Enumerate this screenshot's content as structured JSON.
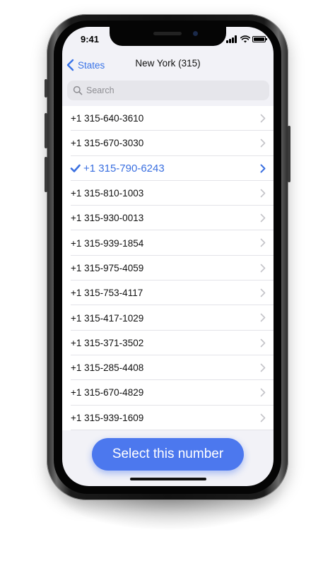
{
  "status_bar": {
    "time": "9:41"
  },
  "nav": {
    "back_label": "States",
    "title": "New York (315)"
  },
  "search": {
    "placeholder": "Search",
    "value": ""
  },
  "numbers": [
    {
      "label": "+1 315-640-3610",
      "selected": false
    },
    {
      "label": "+1 315-670-3030",
      "selected": false
    },
    {
      "label": "+1 315-790-6243",
      "selected": true
    },
    {
      "label": "+1 315-810-1003",
      "selected": false
    },
    {
      "label": "+1 315-930-0013",
      "selected": false
    },
    {
      "label": "+1 315-939-1854",
      "selected": false
    },
    {
      "label": "+1 315-975-4059",
      "selected": false
    },
    {
      "label": "+1 315-753-4117",
      "selected": false
    },
    {
      "label": "+1 315-417-1029",
      "selected": false
    },
    {
      "label": "+1 315-371-3502",
      "selected": false
    },
    {
      "label": "+1 315-285-4408",
      "selected": false
    },
    {
      "label": "+1 315-670-4829",
      "selected": false
    },
    {
      "label": "+1 315-939-1609",
      "selected": false
    }
  ],
  "cta": {
    "label": "Select this number"
  },
  "colors": {
    "accent": "#3a6fe0",
    "button": "#4c78ee",
    "background": "#f2f2f7"
  },
  "icons": [
    "signal-icon",
    "wifi-icon",
    "battery-icon",
    "back-chevron-icon",
    "search-icon",
    "checkmark-icon",
    "chevron-right-icon"
  ]
}
